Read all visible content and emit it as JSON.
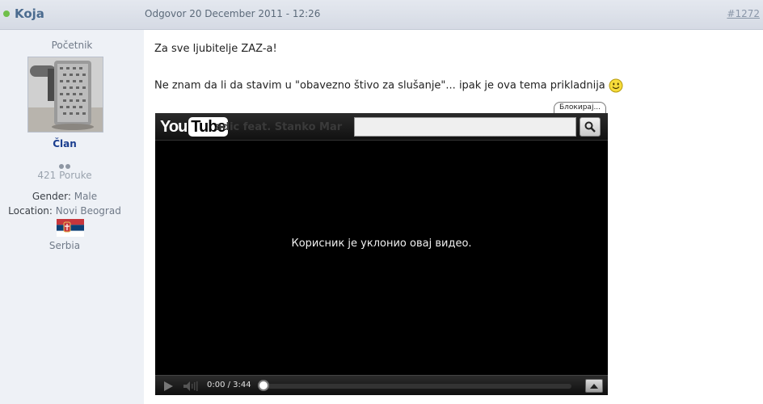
{
  "header": {
    "username": "Koja",
    "post_date": "Odgovor 20 December 2011 - 12:26",
    "post_number": "#1272",
    "online_status_color": "#6fbf4a"
  },
  "sidebar": {
    "rank": "Početnik",
    "usergroup": "Član",
    "posts_count": "421 Poruke",
    "gender_label": "Gender:",
    "gender_value": "Male",
    "location_label": "Location:",
    "location_value": "Novi Beograd",
    "country": "Serbia",
    "flag_icon": "serbia-flag-icon",
    "avatar_icon": "toilet-paper-grater-avatar"
  },
  "post": {
    "line1": "Za sve ljubitelje ZAZ-a!",
    "line2": "Ne znam da li da stavim u \"obavezno štivo za slušanje\"... ipak je ova tema prikladnija",
    "smiley_icon": "smiley-icon",
    "block_button": "Блокирај..."
  },
  "video": {
    "logo_you": "You",
    "logo_tube": "Tube",
    "ghost_title": "adic feat. Stanko Mar",
    "message": "Корисник је уклонио овај видео.",
    "time": "0:00 / 3:44",
    "progress": 0.0,
    "search_icon": "magnifier-icon",
    "play_icon": "play-icon",
    "volume_icon": "volume-icon",
    "expand_icon": "expand-arrow-icon"
  }
}
